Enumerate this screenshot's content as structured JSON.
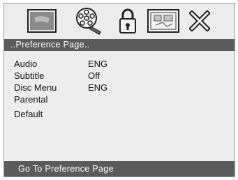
{
  "tabs": [
    {
      "icon": "general-setup-icon"
    },
    {
      "icon": "audio-setup-icon"
    },
    {
      "icon": "lock-icon"
    },
    {
      "icon": "preference-icon"
    },
    {
      "icon": "exit-icon"
    }
  ],
  "header": {
    "title": "..Preference Page.."
  },
  "menu": {
    "items": [
      {
        "label": "Audio",
        "value": "ENG"
      },
      {
        "label": "Subtitle",
        "value": "Off"
      },
      {
        "label": "Disc Menu",
        "value": "ENG"
      },
      {
        "label": "Parental",
        "value": ""
      },
      {
        "label": "Default",
        "value": ""
      }
    ]
  },
  "footer": {
    "hint": "Go To Preference Page"
  }
}
